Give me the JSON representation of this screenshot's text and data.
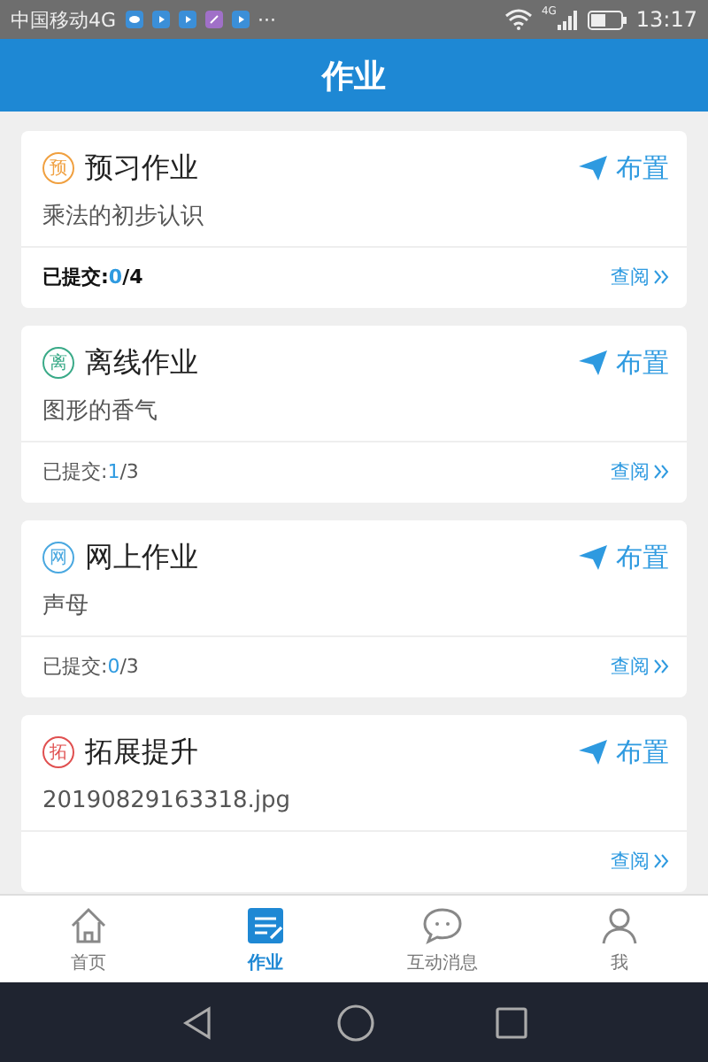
{
  "status_bar": {
    "carrier": "中国移动4G",
    "more": "···",
    "network": "4G",
    "time": "13:17"
  },
  "header": {
    "title": "作业"
  },
  "cards": [
    {
      "badge": "预",
      "color": "#f0a040",
      "title": "预习作业",
      "action": "布置",
      "subtitle": "乘法的初步认识",
      "submitted_label": "已提交:",
      "submitted": "0",
      "total": "/4",
      "emphasis": true,
      "view": "查阅"
    },
    {
      "badge": "离",
      "color": "#3aaa88",
      "title": "离线作业",
      "action": "布置",
      "subtitle": "图形的香气",
      "submitted_label": "已提交:",
      "submitted": "1",
      "total": "/3",
      "emphasis": false,
      "view": "查阅"
    },
    {
      "badge": "网",
      "color": "#4aa8e0",
      "title": "网上作业",
      "action": "布置",
      "subtitle": "声母",
      "submitted_label": "已提交:",
      "submitted": "0",
      "total": "/3",
      "emphasis": false,
      "view": "查阅"
    },
    {
      "badge": "拓",
      "color": "#e05050",
      "title": "拓展提升",
      "action": "布置",
      "subtitle": "20190829163318.jpg",
      "view": "查阅"
    }
  ],
  "tabs": [
    {
      "kind": "home",
      "label": "首页",
      "selected": false
    },
    {
      "kind": "list",
      "label": "作业",
      "selected": true
    },
    {
      "kind": "chat",
      "label": "互动消息",
      "selected": false
    },
    {
      "kind": "person",
      "label": "我",
      "selected": false
    }
  ]
}
